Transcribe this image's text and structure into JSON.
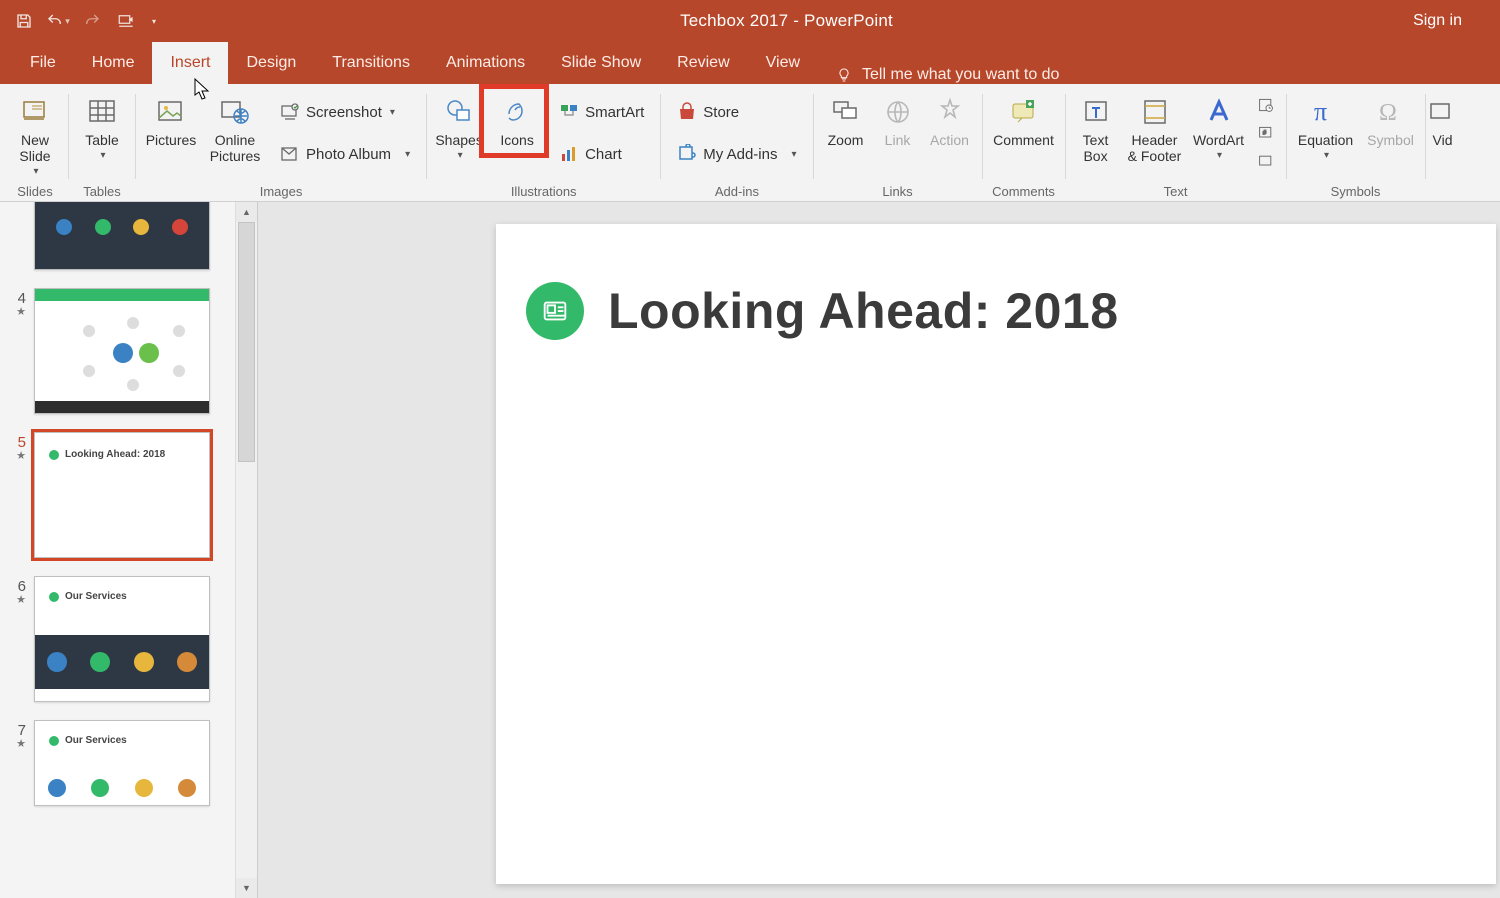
{
  "titlebar": {
    "title": "Techbox 2017  -  PowerPoint",
    "sign_in": "Sign in"
  },
  "tabs": {
    "file": "File",
    "home": "Home",
    "insert": "Insert",
    "design": "Design",
    "transitions": "Transitions",
    "animations": "Animations",
    "slideshow": "Slide Show",
    "review": "Review",
    "view": "View",
    "tellme": "Tell me what you want to do"
  },
  "ribbon": {
    "groups": {
      "slides": "Slides",
      "tables": "Tables",
      "images": "Images",
      "illustrations": "Illustrations",
      "addins": "Add-ins",
      "links": "Links",
      "comments": "Comments",
      "text": "Text",
      "symbols": "Symbols"
    },
    "btn": {
      "new_slide": "New\nSlide",
      "table": "Table",
      "pictures": "Pictures",
      "online_pictures": "Online\nPictures",
      "screenshot": "Screenshot",
      "photo_album": "Photo Album",
      "shapes": "Shapes",
      "icons": "Icons",
      "smartart": "SmartArt",
      "chart": "Chart",
      "store": "Store",
      "my_addins": "My Add-ins",
      "zoom": "Zoom",
      "link": "Link",
      "action": "Action",
      "comment": "Comment",
      "textbox": "Text\nBox",
      "header_footer": "Header\n& Footer",
      "wordart": "WordArt",
      "equation": "Equation",
      "symbol": "Symbol",
      "video": "Vid"
    }
  },
  "thumbs": {
    "n4": "4",
    "n5": "5",
    "n6": "6",
    "n7": "7",
    "s5_title": "Looking Ahead: 2018",
    "s6_title": "Our Services",
    "s7_title": "Our Services"
  },
  "slide": {
    "title": "Looking Ahead: 2018"
  },
  "colors": {
    "accent": "#b7472a",
    "green": "#33b96a"
  }
}
